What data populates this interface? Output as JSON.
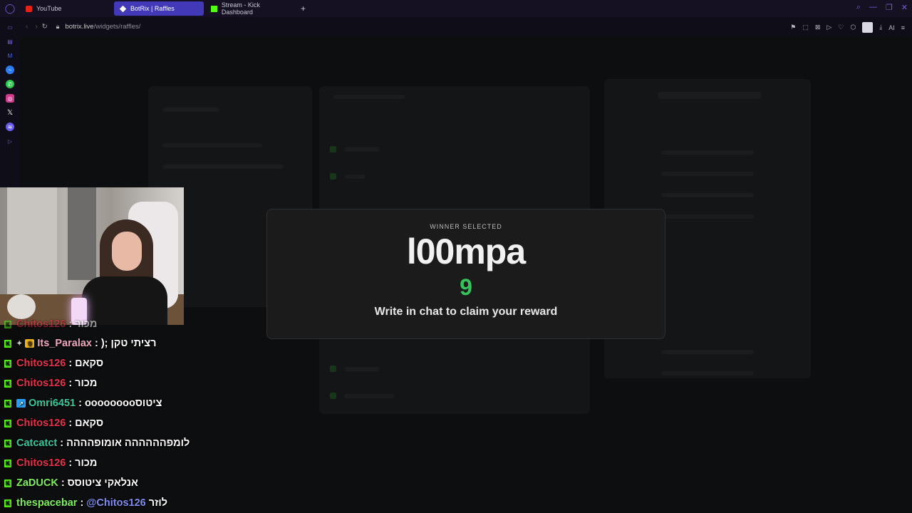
{
  "browser": {
    "tabs": [
      {
        "label": "YouTube",
        "icon": "youtube-icon"
      },
      {
        "label": "BotRix | Raffles",
        "icon": "botrix-icon",
        "active": true
      },
      {
        "label": "Stream - Kick Dashboard",
        "icon": "kick-icon"
      }
    ],
    "new_tab": "+",
    "url_host": "botrix.live",
    "url_path": "/widgets/raffles/",
    "ai_label": "AI"
  },
  "modal": {
    "label": "WINNER SELECTED",
    "winner": "l00mpa",
    "countdown": "9",
    "message": "Write in chat to claim your reward"
  },
  "chat": [
    {
      "user": "Chitos126",
      "color": "#e8314a",
      "message": "מכור",
      "mention": "",
      "badges": [
        "kick"
      ]
    },
    {
      "user": "Its_Paralax",
      "color": "#f0a8c0",
      "message": "רציתי טקן ;(",
      "mention": "",
      "badges": [
        "kick",
        "star",
        "crown"
      ]
    },
    {
      "user": "Chitos126",
      "color": "#e8314a",
      "message": "סקאם",
      "mention": "",
      "badges": [
        "kick"
      ]
    },
    {
      "user": "Chitos126",
      "color": "#e8314a",
      "message": "מכור",
      "mention": "",
      "badges": [
        "kick"
      ]
    },
    {
      "user": "Omri6451",
      "color": "#36c9a0",
      "message": "ציטוסoooooooo",
      "mention": "",
      "badges": [
        "kick",
        "blue"
      ]
    },
    {
      "user": "Chitos126",
      "color": "#e8314a",
      "message": "סקאם",
      "mention": "",
      "badges": [
        "kick"
      ]
    },
    {
      "user": "Catcatct",
      "color": "#36c9a0",
      "message": "לומפהההההה אומופהההה",
      "mention": "",
      "badges": [
        "kick"
      ]
    },
    {
      "user": "Chitos126",
      "color": "#e8314a",
      "message": "מכור",
      "mention": "",
      "badges": [
        "kick"
      ]
    },
    {
      "user": "ZaDUCK",
      "color": "#7cf05a",
      "message": "אנלאקי ציטוסס",
      "mention": "",
      "badges": [
        "kick"
      ]
    },
    {
      "user": "thespacebar",
      "color": "#7cf05a",
      "message": "לוזר",
      "mention": "@Chitos126",
      "badges": [
        "kick"
      ]
    }
  ],
  "colors": {
    "accent": "#4139b8",
    "kick_green": "#53fc18",
    "countdown_green": "#36c35c"
  }
}
